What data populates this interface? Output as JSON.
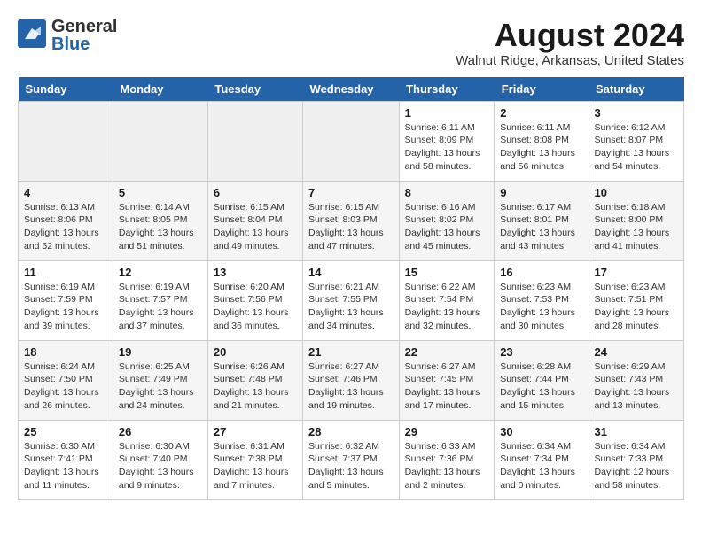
{
  "header": {
    "logo_general": "General",
    "logo_blue": "Blue",
    "month_year": "August 2024",
    "location": "Walnut Ridge, Arkansas, United States"
  },
  "weekdays": [
    "Sunday",
    "Monday",
    "Tuesday",
    "Wednesday",
    "Thursday",
    "Friday",
    "Saturday"
  ],
  "weeks": [
    [
      {
        "day": "",
        "sunrise": "",
        "sunset": "",
        "daylight": ""
      },
      {
        "day": "",
        "sunrise": "",
        "sunset": "",
        "daylight": ""
      },
      {
        "day": "",
        "sunrise": "",
        "sunset": "",
        "daylight": ""
      },
      {
        "day": "",
        "sunrise": "",
        "sunset": "",
        "daylight": ""
      },
      {
        "day": "1",
        "sunrise": "Sunrise: 6:11 AM",
        "sunset": "Sunset: 8:09 PM",
        "daylight": "Daylight: 13 hours and 58 minutes."
      },
      {
        "day": "2",
        "sunrise": "Sunrise: 6:11 AM",
        "sunset": "Sunset: 8:08 PM",
        "daylight": "Daylight: 13 hours and 56 minutes."
      },
      {
        "day": "3",
        "sunrise": "Sunrise: 6:12 AM",
        "sunset": "Sunset: 8:07 PM",
        "daylight": "Daylight: 13 hours and 54 minutes."
      }
    ],
    [
      {
        "day": "4",
        "sunrise": "Sunrise: 6:13 AM",
        "sunset": "Sunset: 8:06 PM",
        "daylight": "Daylight: 13 hours and 52 minutes."
      },
      {
        "day": "5",
        "sunrise": "Sunrise: 6:14 AM",
        "sunset": "Sunset: 8:05 PM",
        "daylight": "Daylight: 13 hours and 51 minutes."
      },
      {
        "day": "6",
        "sunrise": "Sunrise: 6:15 AM",
        "sunset": "Sunset: 8:04 PM",
        "daylight": "Daylight: 13 hours and 49 minutes."
      },
      {
        "day": "7",
        "sunrise": "Sunrise: 6:15 AM",
        "sunset": "Sunset: 8:03 PM",
        "daylight": "Daylight: 13 hours and 47 minutes."
      },
      {
        "day": "8",
        "sunrise": "Sunrise: 6:16 AM",
        "sunset": "Sunset: 8:02 PM",
        "daylight": "Daylight: 13 hours and 45 minutes."
      },
      {
        "day": "9",
        "sunrise": "Sunrise: 6:17 AM",
        "sunset": "Sunset: 8:01 PM",
        "daylight": "Daylight: 13 hours and 43 minutes."
      },
      {
        "day": "10",
        "sunrise": "Sunrise: 6:18 AM",
        "sunset": "Sunset: 8:00 PM",
        "daylight": "Daylight: 13 hours and 41 minutes."
      }
    ],
    [
      {
        "day": "11",
        "sunrise": "Sunrise: 6:19 AM",
        "sunset": "Sunset: 7:59 PM",
        "daylight": "Daylight: 13 hours and 39 minutes."
      },
      {
        "day": "12",
        "sunrise": "Sunrise: 6:19 AM",
        "sunset": "Sunset: 7:57 PM",
        "daylight": "Daylight: 13 hours and 37 minutes."
      },
      {
        "day": "13",
        "sunrise": "Sunrise: 6:20 AM",
        "sunset": "Sunset: 7:56 PM",
        "daylight": "Daylight: 13 hours and 36 minutes."
      },
      {
        "day": "14",
        "sunrise": "Sunrise: 6:21 AM",
        "sunset": "Sunset: 7:55 PM",
        "daylight": "Daylight: 13 hours and 34 minutes."
      },
      {
        "day": "15",
        "sunrise": "Sunrise: 6:22 AM",
        "sunset": "Sunset: 7:54 PM",
        "daylight": "Daylight: 13 hours and 32 minutes."
      },
      {
        "day": "16",
        "sunrise": "Sunrise: 6:23 AM",
        "sunset": "Sunset: 7:53 PM",
        "daylight": "Daylight: 13 hours and 30 minutes."
      },
      {
        "day": "17",
        "sunrise": "Sunrise: 6:23 AM",
        "sunset": "Sunset: 7:51 PM",
        "daylight": "Daylight: 13 hours and 28 minutes."
      }
    ],
    [
      {
        "day": "18",
        "sunrise": "Sunrise: 6:24 AM",
        "sunset": "Sunset: 7:50 PM",
        "daylight": "Daylight: 13 hours and 26 minutes."
      },
      {
        "day": "19",
        "sunrise": "Sunrise: 6:25 AM",
        "sunset": "Sunset: 7:49 PM",
        "daylight": "Daylight: 13 hours and 24 minutes."
      },
      {
        "day": "20",
        "sunrise": "Sunrise: 6:26 AM",
        "sunset": "Sunset: 7:48 PM",
        "daylight": "Daylight: 13 hours and 21 minutes."
      },
      {
        "day": "21",
        "sunrise": "Sunrise: 6:27 AM",
        "sunset": "Sunset: 7:46 PM",
        "daylight": "Daylight: 13 hours and 19 minutes."
      },
      {
        "day": "22",
        "sunrise": "Sunrise: 6:27 AM",
        "sunset": "Sunset: 7:45 PM",
        "daylight": "Daylight: 13 hours and 17 minutes."
      },
      {
        "day": "23",
        "sunrise": "Sunrise: 6:28 AM",
        "sunset": "Sunset: 7:44 PM",
        "daylight": "Daylight: 13 hours and 15 minutes."
      },
      {
        "day": "24",
        "sunrise": "Sunrise: 6:29 AM",
        "sunset": "Sunset: 7:43 PM",
        "daylight": "Daylight: 13 hours and 13 minutes."
      }
    ],
    [
      {
        "day": "25",
        "sunrise": "Sunrise: 6:30 AM",
        "sunset": "Sunset: 7:41 PM",
        "daylight": "Daylight: 13 hours and 11 minutes."
      },
      {
        "day": "26",
        "sunrise": "Sunrise: 6:30 AM",
        "sunset": "Sunset: 7:40 PM",
        "daylight": "Daylight: 13 hours and 9 minutes."
      },
      {
        "day": "27",
        "sunrise": "Sunrise: 6:31 AM",
        "sunset": "Sunset: 7:38 PM",
        "daylight": "Daylight: 13 hours and 7 minutes."
      },
      {
        "day": "28",
        "sunrise": "Sunrise: 6:32 AM",
        "sunset": "Sunset: 7:37 PM",
        "daylight": "Daylight: 13 hours and 5 minutes."
      },
      {
        "day": "29",
        "sunrise": "Sunrise: 6:33 AM",
        "sunset": "Sunset: 7:36 PM",
        "daylight": "Daylight: 13 hours and 2 minutes."
      },
      {
        "day": "30",
        "sunrise": "Sunrise: 6:34 AM",
        "sunset": "Sunset: 7:34 PM",
        "daylight": "Daylight: 13 hours and 0 minutes."
      },
      {
        "day": "31",
        "sunrise": "Sunrise: 6:34 AM",
        "sunset": "Sunset: 7:33 PM",
        "daylight": "Daylight: 12 hours and 58 minutes."
      }
    ]
  ]
}
